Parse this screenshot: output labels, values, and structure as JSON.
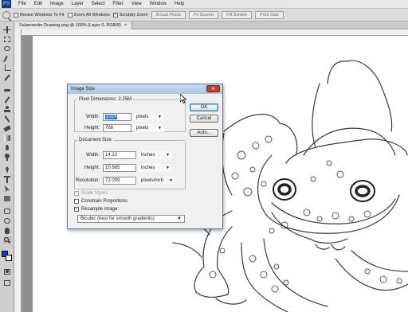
{
  "app": {
    "logo": "PS",
    "menu": [
      "File",
      "Edit",
      "Image",
      "Layer",
      "Select",
      "Filter",
      "View",
      "Window",
      "Help"
    ]
  },
  "options_bar": {
    "tool_icon": "zoom-icon",
    "checkboxes": [
      {
        "label": "Resize Windows To Fit",
        "checked": false
      },
      {
        "label": "Zoom All Windows",
        "checked": false
      },
      {
        "label": "Scrubby Zoom",
        "checked": true
      }
    ],
    "buttons": [
      "Actual Pixels",
      "Fit Screen",
      "Fill Screen",
      "Print Size"
    ]
  },
  "document_tab": {
    "title": "Salamander Drawing.png @ 100% (Layer 0, RGB/8)",
    "close": "×"
  },
  "dialog": {
    "title": "Image Size",
    "close": "×",
    "pixel_dimensions": {
      "legend": "Pixel Dimensions: 2.25M",
      "width_label": "Width:",
      "width_value": "1024",
      "width_unit": "pixels",
      "height_label": "Height:",
      "height_value": "768",
      "height_unit": "pixels"
    },
    "document_size": {
      "legend": "Document Size:",
      "width_label": "Width:",
      "width_value": "14.22",
      "width_unit": "inches",
      "height_label": "Height:",
      "height_value": "10.665",
      "height_unit": "inches",
      "resolution_label": "Resolution:",
      "resolution_value": "72.009",
      "resolution_unit": "pixels/inch"
    },
    "scale_styles": {
      "label": "Scale Styles",
      "checked": false,
      "enabled": false
    },
    "constrain_proportions": {
      "label": "Constrain Proportions",
      "checked": false
    },
    "resample_image": {
      "label": "Resample Image:",
      "checked": true
    },
    "resample_method": "Bicubic (best for smooth gradients)",
    "buttons": {
      "ok": "OK",
      "cancel": "Cancel",
      "auto": "Auto..."
    }
  },
  "colors": {
    "foreground": "#1a3ad6",
    "background": "#ffffff",
    "dialog_title_bg": "#b7cee9",
    "close_button": "#c7402b"
  }
}
